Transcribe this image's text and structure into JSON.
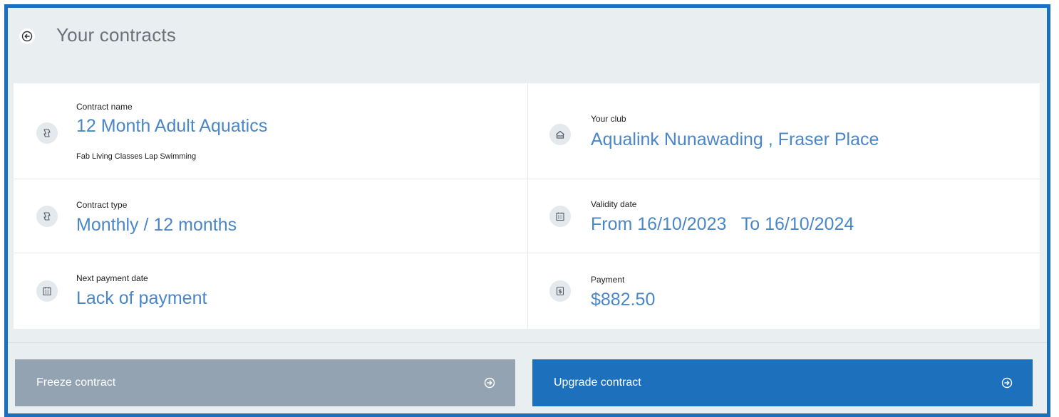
{
  "header": {
    "title": "Your contracts"
  },
  "contract": {
    "name_label": "Contract name",
    "name_value": "12 Month Adult Aquatics",
    "name_sub": "Fab Living Classes Lap Swimming",
    "club_label": "Your club",
    "club_value": "Aqualink Nunawading , Fraser Place",
    "type_label": "Contract type",
    "type_value": "Monthly / 12 months",
    "validity_label": "Validity date",
    "validity_value": "From 16/10/2023   To 16/10/2024",
    "next_payment_label": "Next payment date",
    "next_payment_value": "Lack of payment",
    "payment_label": "Payment",
    "payment_value": "$882.50"
  },
  "actions": {
    "freeze_label": "Freeze contract",
    "upgrade_label": "Upgrade contract"
  },
  "colors": {
    "frame_border": "#1b6fc0",
    "value_text": "#4a86c8",
    "freeze_button": "#93a3b1",
    "upgrade_button": "#1d70bb",
    "background": "#e9eef1"
  },
  "icons": {
    "back": "arrow-circle-left-icon",
    "contract": "ticket-icon",
    "club": "building-icon",
    "calendar": "calendar-icon",
    "payment": "dollar-icon",
    "button_arrow": "arrow-circle-right-icon"
  }
}
